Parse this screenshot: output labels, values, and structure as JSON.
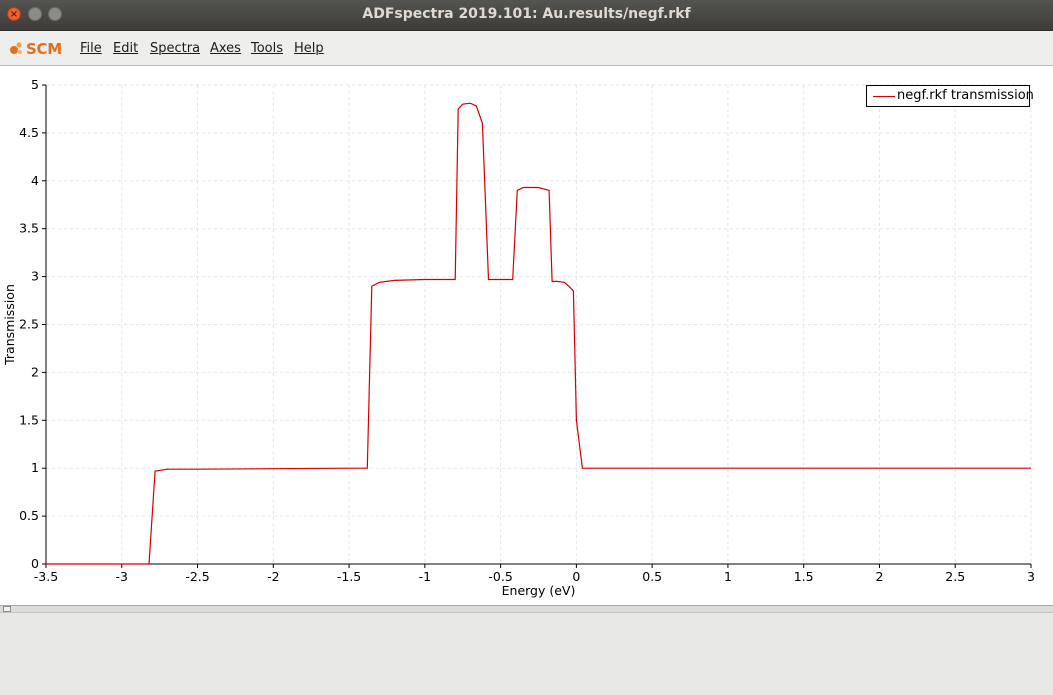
{
  "window": {
    "title": "ADFspectra 2019.101: Au.results/negf.rkf",
    "close_glyph": "×",
    "min_glyph": "–",
    "max_glyph": "□"
  },
  "menubar": {
    "logo_text": "SCM",
    "logo_color": "#e56f1c",
    "items": [
      "File",
      "Edit",
      "Spectra",
      "Axes",
      "Tools",
      "Help"
    ]
  },
  "chart_data": {
    "type": "line",
    "xlabel": "Energy (eV)",
    "ylabel": "Transmission",
    "xlim": [
      -3.5,
      3
    ],
    "ylim": [
      0,
      5
    ],
    "xticks": [
      -3.5,
      -3,
      -2.5,
      -2,
      -1.5,
      -1,
      -0.5,
      0,
      0.5,
      1,
      1.5,
      2,
      2.5,
      3
    ],
    "xtick_labels": [
      "-3.5",
      "-3",
      "-2.5",
      "-2",
      "-1.5",
      "-1",
      "-0.5",
      "0",
      "0.5",
      "1",
      "1.5",
      "2",
      "2.5",
      "3"
    ],
    "yticks": [
      0,
      0.5,
      1,
      1.5,
      2,
      2.5,
      3,
      3.5,
      4,
      4.5,
      5
    ],
    "ytick_labels": [
      "0",
      "0.5",
      "1",
      "1.5",
      "2",
      "2.5",
      "3",
      "3.5",
      "4",
      "4.5",
      "5"
    ],
    "grid": true,
    "legend_position": "top-right",
    "series": [
      {
        "name": "negf.rkf transmission",
        "color": "#d40000",
        "x": [
          -3.5,
          -2.82,
          -2.78,
          -2.7,
          -2.5,
          -2.0,
          -1.5,
          -1.38,
          -1.35,
          -1.3,
          -1.2,
          -1.0,
          -0.8,
          -0.78,
          -0.75,
          -0.7,
          -0.66,
          -0.62,
          -0.58,
          -0.5,
          -0.42,
          -0.39,
          -0.35,
          -0.25,
          -0.18,
          -0.16,
          -0.13,
          -0.08,
          -0.05,
          -0.02,
          0.0,
          0.04,
          0.5,
          1.0,
          2.0,
          3.0
        ],
        "y": [
          0,
          0,
          0.97,
          0.99,
          0.99,
          0.995,
          1.0,
          1.0,
          2.9,
          2.94,
          2.96,
          2.97,
          2.97,
          4.75,
          4.8,
          4.81,
          4.78,
          4.6,
          2.97,
          2.97,
          2.97,
          3.9,
          3.93,
          3.93,
          3.9,
          2.95,
          2.95,
          2.94,
          2.9,
          2.85,
          1.5,
          1.0,
          1.0,
          1.0,
          1.0,
          1.0
        ]
      }
    ]
  }
}
